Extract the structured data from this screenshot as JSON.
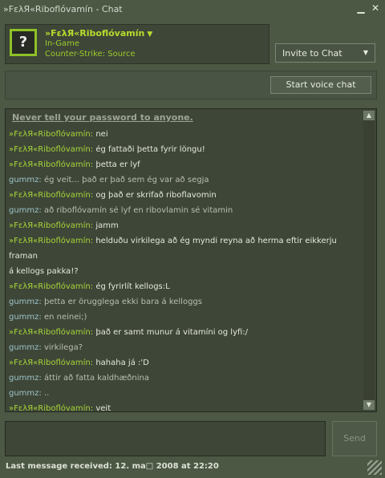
{
  "window": {
    "title": "»FελЯ«Riboflóvamín - Chat",
    "minimize_glyph": "▁",
    "close_glyph": "✕"
  },
  "friend": {
    "avatar_glyph": "?",
    "name": "»FελЯ«Riboflóvamín",
    "status": "In-Game",
    "game": "Counter-Strike: Source",
    "name_color": "#b7dd2e",
    "avatar_border_color": "#8ec127"
  },
  "toolbar": {
    "invite_label": "Invite to Chat",
    "voice_label": "Start voice chat"
  },
  "chat": {
    "warning": "Never tell your password to anyone.",
    "messages": [
      {
        "sender": "»FελЯ«Riboflóvamín",
        "text": "nei"
      },
      {
        "sender": "»FελЯ«Riboflóvamín",
        "text": "ég fattaði þetta fyrir löngu!"
      },
      {
        "sender": "»FελЯ«Riboflóvamín",
        "text": "þetta er lyf"
      },
      {
        "sender": "gummz",
        "text": "ég veit... það er það sem ég var að segja"
      },
      {
        "sender": "»FελЯ«Riboflóvamín",
        "text": "og það er skrifað riboflavomin"
      },
      {
        "sender": "gummz",
        "text": "að riboflóvamín sé lyf en ribovlamin sé vitamin"
      },
      {
        "sender": "»FελЯ«Riboflóvamín",
        "text": "jamm"
      },
      {
        "sender": "»FελЯ«Riboflóvamín",
        "text": "helduðu virkilega að ég myndi reyna að herma eftir eikkerju framan"
      },
      {
        "sender": "",
        "text": "á kellogs pakka!?"
      },
      {
        "sender": "»FελЯ«Riboflóvamín",
        "text": "ég fyrirlít kellogs:L"
      },
      {
        "sender": "gummz",
        "text": "þetta er örugglega ekki bara á kelloggs"
      },
      {
        "sender": "gummz",
        "text": "en neinei;)"
      },
      {
        "sender": "»FελЯ«Riboflóvamín",
        "text": "það er samt munur á vitamíni og lyfi:/"
      },
      {
        "sender": "gummz",
        "text": "virkilega?"
      },
      {
        "sender": "»FελЯ«Riboflóvamín",
        "text": "hahaha já :'D"
      },
      {
        "sender": "gummz",
        "text": "áttir að fatta kaldhæðnina"
      },
      {
        "sender": "gummz",
        "text": ".."
      },
      {
        "sender": "»FελЯ«Riboflóvamín",
        "text": "veit"
      }
    ],
    "scroll_up_glyph": "▲",
    "scroll_down_glyph": "▼"
  },
  "input": {
    "send_label": "Send"
  },
  "footer": {
    "last_message": "Last message received: 12. ma□ 2008 at 22:20"
  }
}
